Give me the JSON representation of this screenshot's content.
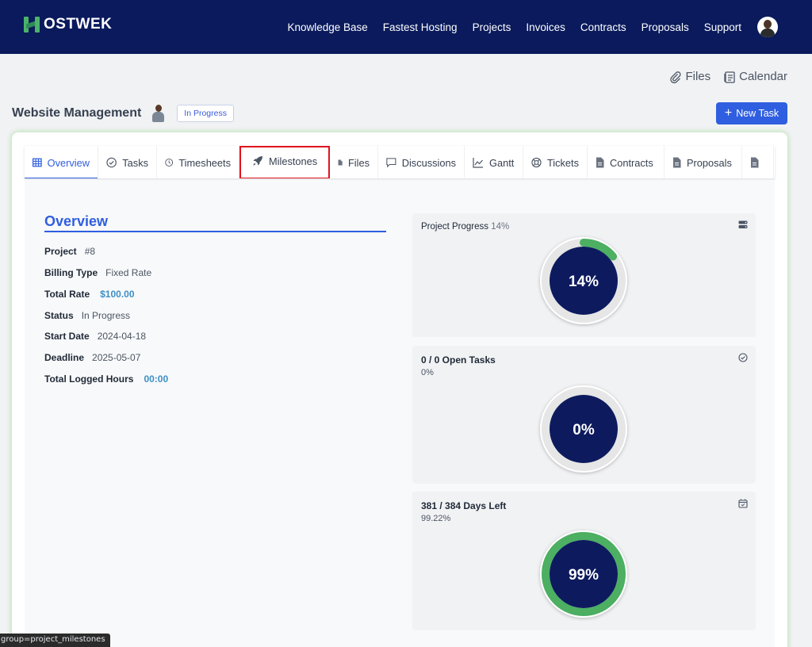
{
  "brand": {
    "name": "OSTWEK",
    "accent": "#4bb36a",
    "navbar_bg": "#0a1a5c"
  },
  "nav": {
    "items": [
      "Knowledge Base",
      "Fastest Hosting",
      "Projects",
      "Invoices",
      "Contracts",
      "Proposals",
      "Support"
    ]
  },
  "toolbar": {
    "files_label": "Files",
    "calendar_label": "Calendar"
  },
  "project": {
    "title": "Website Management",
    "status": "In Progress"
  },
  "actions": {
    "new_task_label": "New Task"
  },
  "tabs": [
    {
      "label": "Overview",
      "icon": "grid-icon"
    },
    {
      "label": "Tasks",
      "icon": "check-circle-icon"
    },
    {
      "label": "Timesheets",
      "icon": "clock-icon"
    },
    {
      "label": "Milestones",
      "icon": "rocket-icon"
    },
    {
      "label": "Files",
      "icon": "file-icon"
    },
    {
      "label": "Discussions",
      "icon": "chat-icon"
    },
    {
      "label": "Gantt",
      "icon": "chart-icon"
    },
    {
      "label": "Tickets",
      "icon": "lifebuoy-icon"
    },
    {
      "label": "Contracts",
      "icon": "document-icon"
    },
    {
      "label": "Proposals",
      "icon": "document-icon"
    }
  ],
  "overview": {
    "title": "Overview",
    "fields": [
      {
        "label": "Project",
        "value": "#8"
      },
      {
        "label": "Billing Type",
        "value": "Fixed Rate"
      },
      {
        "label": "Total Rate",
        "value": "$100.00"
      },
      {
        "label": "Status",
        "value": "In Progress"
      },
      {
        "label": "Start Date",
        "value": "2024-04-18"
      },
      {
        "label": "Deadline",
        "value": "2025-05-07"
      },
      {
        "label": "Total Logged Hours",
        "value": "00:00"
      }
    ]
  },
  "stats": {
    "progress": {
      "title": "Project Progress",
      "percent_text": "14%",
      "center": "14%",
      "fraction": 0.14
    },
    "tasks": {
      "title": "0 / 0 Open Tasks",
      "sub": "0%",
      "center": "0%",
      "fraction": 0
    },
    "days": {
      "title": "381 / 384 Days Left",
      "sub": "99.22%",
      "center": "99%",
      "fraction": 0.9922
    }
  },
  "colors": {
    "ring_fill": "#0d1b5e",
    "ring_progress": "#4caf62",
    "ring_track": "#e6e6e6",
    "primary": "#2f5ee0",
    "highlight": "#e0141e"
  },
  "status_url": "group=project_milestones"
}
